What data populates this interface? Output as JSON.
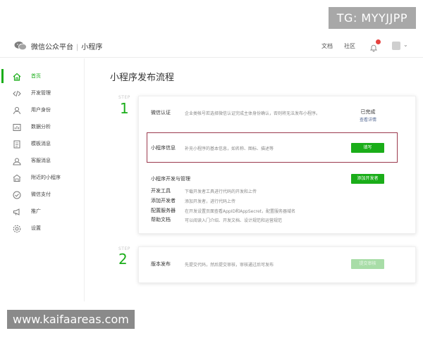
{
  "watermarks": {
    "top": "TG: MYYJJPP",
    "bottom": "www.kaifaareas.com"
  },
  "header": {
    "brand": "微信公众平台",
    "section": "小程序",
    "links": {
      "doc": "文档",
      "community": "社区"
    }
  },
  "sidebar": {
    "items": [
      {
        "label": "首页",
        "icon": "home-icon",
        "active": true
      },
      {
        "label": "开发管理",
        "icon": "code-icon",
        "active": false
      },
      {
        "label": "用户身份",
        "icon": "user-icon",
        "active": false
      },
      {
        "label": "数据分析",
        "icon": "chart-icon",
        "active": false
      },
      {
        "label": "模板消息",
        "icon": "document-icon",
        "active": false
      },
      {
        "label": "客服消息",
        "icon": "support-icon",
        "active": false
      },
      {
        "label": "附近的小程序",
        "icon": "location-icon",
        "active": false
      },
      {
        "label": "微信支付",
        "icon": "payment-icon",
        "active": false
      },
      {
        "label": "推广",
        "icon": "megaphone-icon",
        "active": false
      },
      {
        "label": "设置",
        "icon": "gear-icon",
        "active": false
      }
    ]
  },
  "main": {
    "title": "小程序发布流程",
    "step1": {
      "small": "STEP",
      "number": "1",
      "verify": {
        "title": "微信认证",
        "desc": "企业类帐号若选择微信认证完成主体身份确认，否则将无法发布小程序。",
        "status": "已完成",
        "link": "查看详情"
      },
      "info": {
        "title": "小程序信息",
        "desc": "补充小程序的基本信息，如名称、图标、描述等",
        "button": "填写"
      },
      "dev": {
        "title": "小程序开发与管理",
        "button": "添加开发者",
        "rows": [
          {
            "title": "开发工具",
            "desc": "下载开发者工具进行代码的开发和上传"
          },
          {
            "title": "添加开发者",
            "desc": "添加开发者，进行代码上传"
          },
          {
            "title": "配置服务器",
            "desc": "在开发设置页面查看AppID和AppSecret，配置服务器域名"
          },
          {
            "title": "帮助文档",
            "desc": "可以阅读入门介绍、开发文档、设计规范和运营规范"
          }
        ]
      }
    },
    "step2": {
      "small": "STEP",
      "number": "2",
      "publish": {
        "title": "版本发布",
        "desc": "先提交代码，然后提交审核，审核通过后可发布",
        "button": "提交审核"
      }
    }
  },
  "colors": {
    "accent": "#1aad19",
    "highlight": "#9b3a4e",
    "link": "#576b95"
  }
}
